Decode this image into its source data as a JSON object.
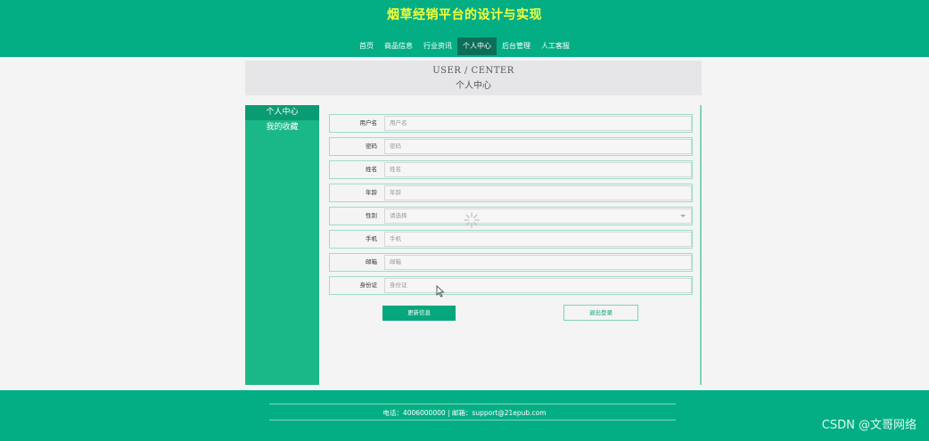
{
  "header": {
    "title": "烟草经销平台的设计与实现",
    "nav": [
      {
        "label": "首页",
        "active": false
      },
      {
        "label": "商品信息",
        "active": false
      },
      {
        "label": "行业资讯",
        "active": false
      },
      {
        "label": "个人中心",
        "active": true
      },
      {
        "label": "后台管理",
        "active": false
      },
      {
        "label": "人工客服",
        "active": false
      }
    ]
  },
  "banner": {
    "en": "USER / CENTER",
    "cn": "个人中心"
  },
  "sidebar": {
    "items": [
      {
        "label": "个人中心",
        "active": true
      },
      {
        "label": "我的收藏",
        "active": false
      }
    ]
  },
  "form": {
    "fields": [
      {
        "label": "用户名",
        "placeholder": "用户名"
      },
      {
        "label": "密码",
        "placeholder": "密码"
      },
      {
        "label": "姓名",
        "placeholder": "姓名"
      },
      {
        "label": "年龄",
        "placeholder": "年龄"
      },
      {
        "label": "性别",
        "placeholder": "请选择"
      },
      {
        "label": "手机",
        "placeholder": "手机"
      },
      {
        "label": "邮箱",
        "placeholder": "邮箱"
      },
      {
        "label": "身份证",
        "placeholder": "身份证"
      }
    ],
    "update_button": "更新信息",
    "logout_button": "退出登录"
  },
  "footer": {
    "contact": "电话：4006000000 | 邮箱：support@21epub.com"
  },
  "watermark": "CSDN @文哥网络",
  "colors": {
    "primary": "#03ae85",
    "title": "#f4ff3a",
    "nav_active": "#0d6e57"
  }
}
